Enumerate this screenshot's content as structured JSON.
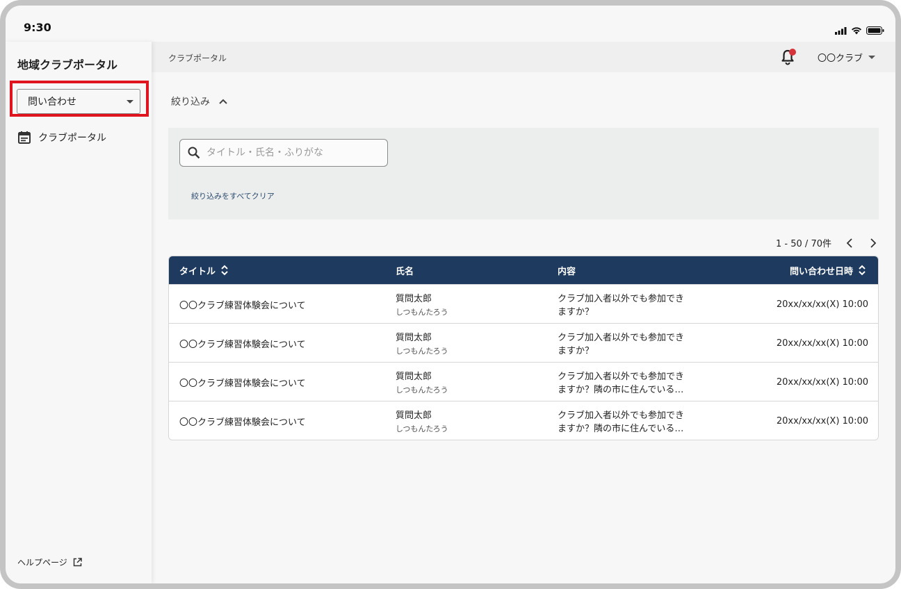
{
  "status": {
    "time": "9:30"
  },
  "sidebar": {
    "app_title": "地域クラブポータル",
    "select_value": "問い合わせ",
    "nav_item": "クラブポータル",
    "help": "ヘルプページ"
  },
  "header": {
    "breadcrumb": "クラブポータル",
    "club": "〇〇クラブ"
  },
  "filter": {
    "toggle_label": "絞り込み",
    "search_placeholder": "タイトル・氏名・ふりがな",
    "clear_label": "絞り込みをすべてクリア"
  },
  "pager": {
    "range": "1 - 50 / 70件"
  },
  "table": {
    "columns": [
      "タイトル",
      "氏名",
      "内容",
      "問い合わせ日時"
    ],
    "rows": [
      {
        "title": "〇〇クラブ練習体験会について",
        "name": "質問太郎",
        "kana": "しつもんたろう",
        "line1": "クラブ加入者以外でも参加でき",
        "line2": "ますか？",
        "datetime": "20xx/xx/xx(X) 10:00"
      },
      {
        "title": "〇〇クラブ練習体験会について",
        "name": "質問太郎",
        "kana": "しつもんたろう",
        "line1": "クラブ加入者以外でも参加でき",
        "line2": "ますか？",
        "datetime": "20xx/xx/xx(X) 10:00"
      },
      {
        "title": "〇〇クラブ練習体験会について",
        "name": "質問太郎",
        "kana": "しつもんたろう",
        "line1": "クラブ加入者以外でも参加でき",
        "line2": "ますか？隣の市に住んでいる…",
        "datetime": "20xx/xx/xx(X) 10:00"
      },
      {
        "title": "〇〇クラブ練習体験会について",
        "name": "質問太郎",
        "kana": "しつもんたろう",
        "line1": "クラブ加入者以外でも参加でき",
        "line2": "ますか？隣の市に住んでいる…",
        "datetime": "20xx/xx/xx(X) 10:00"
      }
    ]
  },
  "colors": {
    "header_bg": "#1e3a5f",
    "highlight": "#e0141e",
    "notification": "#d6343a"
  }
}
